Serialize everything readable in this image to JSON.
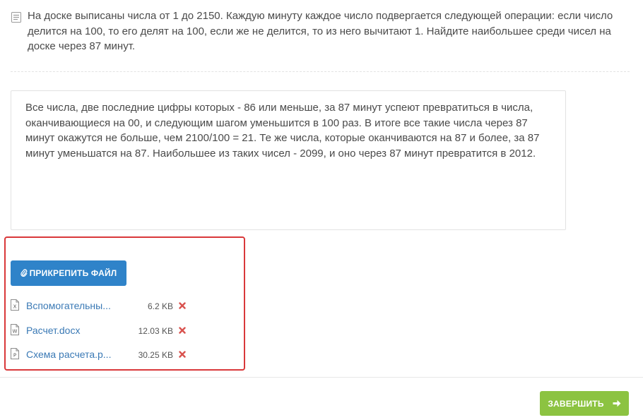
{
  "question": {
    "icon": "document-list-icon",
    "text": "На доске выписаны числа от 1 до 2150. Каждую минуту каждое число подвергается следующей операции: если число делится на 100, то его делят на 100, если же не делится, то из него вычитают 1. Найдите наибольшее среди чисел на доске через 87 минут."
  },
  "answer": {
    "text": "Все числа, две последние цифры которых - 86 или меньше, за 87 минут успеют превратиться в числа, оканчивающиеся на 00, и следующим шагом уменьшится в 100 раз. В итоге все такие числа через 87 минут окажутся не больше, чем 2100/100 = 21. Те же числа, которые оканчиваются на 87 и более, за 87 минут уменьшатся на 87. Наибольшее из таких чисел - 2099, и оно через 87 минут превратится в 2012."
  },
  "attachments": {
    "button_label": "ПРИКРЕПИТЬ ФАЙЛ",
    "button_icon": "paperclip-icon",
    "files": [
      {
        "name": "Вспомогательны...",
        "size": "6.2 KB",
        "type_letter": "X",
        "icon": "excel-file-icon"
      },
      {
        "name": "Расчет.docx",
        "size": "12.03 KB",
        "type_letter": "W",
        "icon": "word-file-icon"
      },
      {
        "name": "Схема расчета.р...",
        "size": "30.25 KB",
        "type_letter": "P",
        "icon": "powerpoint-file-icon"
      }
    ]
  },
  "footer": {
    "finish_label": "ЗАВЕРШИТЬ",
    "finish_icon": "arrow-right-icon"
  },
  "colors": {
    "attach_button": "#2f83c9",
    "finish_button": "#8cc341",
    "highlight_border": "#d9383a",
    "file_link": "#3a79b5",
    "delete": "#d9534f"
  }
}
